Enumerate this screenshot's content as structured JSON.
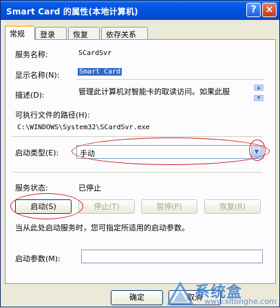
{
  "window": {
    "title": "Smart Card 的属性(本地计算机)",
    "help_glyph": "?",
    "close_glyph": "×"
  },
  "tabs": [
    {
      "label": "常规",
      "active": true
    },
    {
      "label": "登录",
      "active": false
    },
    {
      "label": "恢复",
      "active": false
    },
    {
      "label": "依存关系",
      "active": false
    }
  ],
  "general": {
    "service_name_label": "服务名称:",
    "service_name_value": "SCardSvr",
    "display_name_label": "显示名称(N):",
    "display_name_value": "Smart Card",
    "description_label": "描述(D):",
    "description_value": "管理此计算机对智能卡的取读访问。如果此服",
    "exe_path_label": "可执行文件的路径(H):",
    "exe_path_value": "C:\\WINDOWS\\System32\\SCardSvr.exe",
    "startup_type_label": "启动类型(E):",
    "startup_type_value": "手动",
    "service_status_label": "服务状态:",
    "service_status_value": "已停止",
    "start_button": "启动(S)",
    "stop_button": "停止(T)",
    "pause_button": "暂停(P)",
    "resume_button": "恢复(R)",
    "hint_text": "当从此处启动服务时，您可指定所适用的启动参数。",
    "start_params_label": "启动参数(M):",
    "start_params_value": ""
  },
  "footer": {
    "ok_button": "确定",
    "cancel_button": "取消"
  },
  "watermark": {
    "text": "系统盒",
    "url": "www.xitonghe.com"
  },
  "colors": {
    "titlebar": "#0054e3",
    "selection": "#316ac5",
    "annotation": "#d01c1c"
  }
}
